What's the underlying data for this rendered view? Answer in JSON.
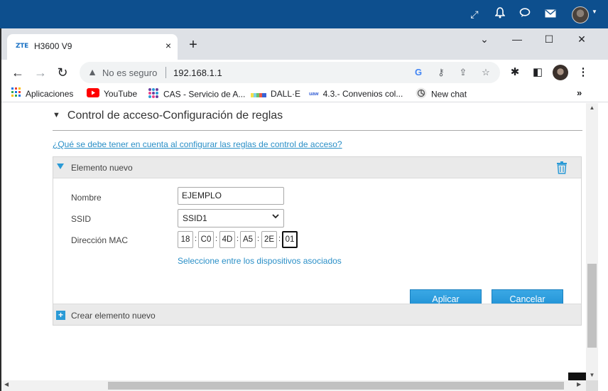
{
  "tab": {
    "favicon_text": "ZTE",
    "title": "H3600 V9",
    "close": "×",
    "new_tab": "+"
  },
  "window_controls": {
    "tabsearch": "⌄",
    "minimize": "—",
    "maximize": "☐",
    "close": "✕"
  },
  "address_bar": {
    "security_label": "No es seguro",
    "url": "192.168.1.1"
  },
  "bookmarks": [
    {
      "label": "Aplicaciones",
      "icon": "apps-grid-icon"
    },
    {
      "label": "YouTube",
      "icon": "youtube-icon"
    },
    {
      "label": "CAS - Servicio de A...",
      "icon": "cas-icon"
    },
    {
      "label": "DALL·E",
      "icon": "dalle-icon"
    },
    {
      "label": "4.3.- Convenios col...",
      "icon": "uaw-icon"
    },
    {
      "label": "New chat",
      "icon": "openai-icon"
    }
  ],
  "bookmarks_more": "»",
  "page": {
    "section_title": "Control de acceso-Configuración de reglas",
    "help_link": "¿Qué se debe tener en cuenta al configurar las reglas de control de acceso?",
    "panel_title": "Elemento nuevo",
    "form": {
      "name_label": "Nombre",
      "name_value": "EJEMPLO",
      "ssid_label": "SSID",
      "ssid_value": "SSID1",
      "mac_label": "Dirección MAC",
      "mac_octets": [
        "18",
        "C0",
        "4D",
        "A5",
        "2E",
        "01"
      ],
      "mac_separator": ":",
      "assoc_link": "Seleccione entre los dispositivos asociados"
    },
    "buttons": {
      "apply": "Aplicar",
      "cancel": "Cancelar"
    },
    "create_new": "Crear elemento nuevo"
  },
  "colors": {
    "outer_bar": "#0d4f8e",
    "link_blue": "#2a8fc7",
    "button_blue": "#1d8ed2",
    "panel_gray": "#eaeaea"
  }
}
